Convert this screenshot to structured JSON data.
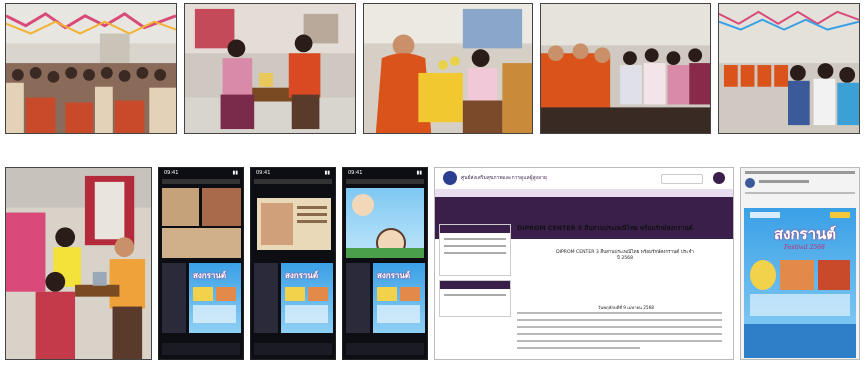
{
  "photos_top": [
    {
      "caption": ""
    },
    {
      "caption": ""
    },
    {
      "caption": ""
    },
    {
      "caption": ""
    },
    {
      "caption": ""
    }
  ],
  "phone_screens": [
    {
      "time": "09:41",
      "poster_title": "สงกรานต์"
    },
    {
      "time": "09:41",
      "poster_title": "สงกรานต์"
    },
    {
      "time": "09:41",
      "poster_title": "สงกรานต์"
    }
  ],
  "website": {
    "org_name": "ศูนย์ส่งเสริมสุขภาพและการดูแลผู้สูงอายุ",
    "article_title": "DIPROM CENTER 3 สืบสานประเพณีไทย พร้อมรักษ์สงกรานต์",
    "article_sub": "DIPROM CENTER 3 สืบสานประเพณีไทย พร้อมรักษ์สงกรานต์ ประจำปี 2568",
    "article_date": "วันพฤหัสบดีที่ 9 เมษายน 2568"
  },
  "social_post": {
    "poster_title": "สงกรานต์",
    "poster_sub": "Festival 2568"
  },
  "colors": {
    "web_dark": "#3a1f4a",
    "poster_blue": "#3aa0e6",
    "poster_pink": "#c0266a"
  }
}
